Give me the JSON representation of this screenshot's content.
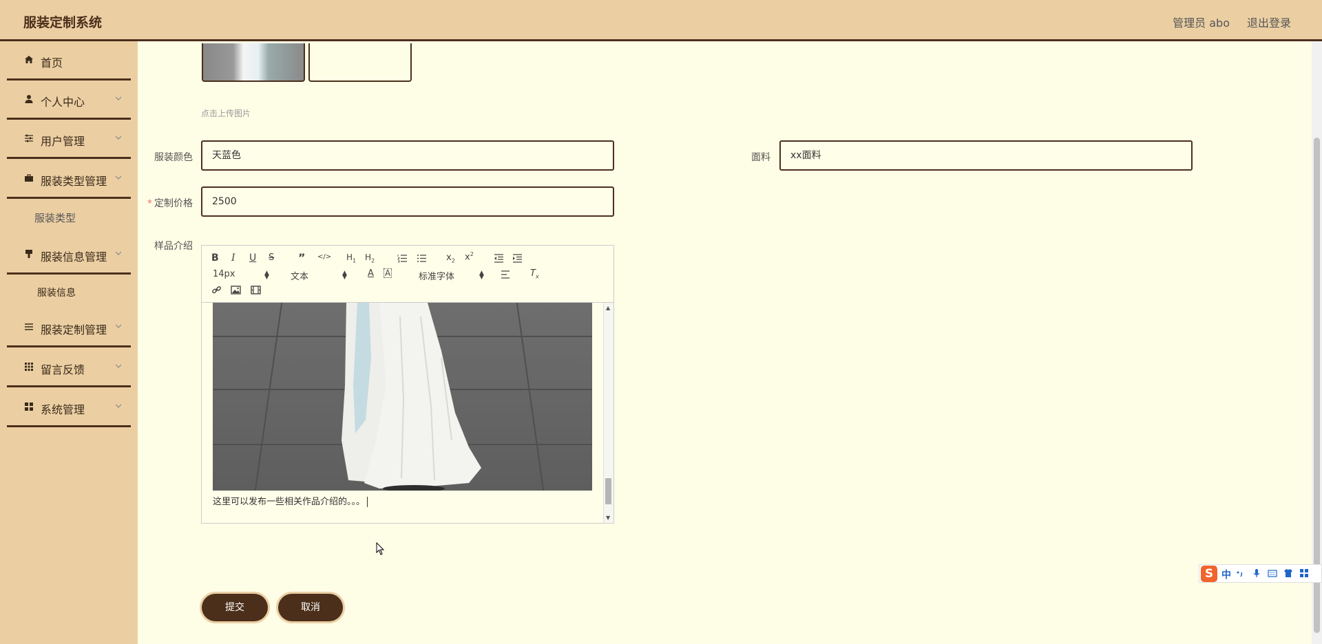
{
  "header": {
    "title": "服装定制系统",
    "user": "管理员 abo",
    "logout": "退出登录"
  },
  "sidebar": {
    "items": [
      {
        "label": "首页",
        "icon": "home-icon"
      },
      {
        "label": "个人中心",
        "icon": "user-icon"
      },
      {
        "label": "用户管理",
        "icon": "sliders-icon"
      },
      {
        "label": "服装类型管理",
        "icon": "briefcase-icon"
      },
      {
        "label": "服装信息管理",
        "icon": "brush-icon"
      },
      {
        "label": "服装定制管理",
        "icon": "list-icon"
      },
      {
        "label": "留言反馈",
        "icon": "grid-icon"
      },
      {
        "label": "系统管理",
        "icon": "apps-icon"
      }
    ],
    "subitems": {
      "type": "服装类型",
      "info": "服装信息"
    }
  },
  "form": {
    "upload_tip": "点击上传图片",
    "color_label": "服装颜色",
    "color_value": "天蓝色",
    "fabric_label": "面料",
    "fabric_value": "xx面料",
    "price_label": "定制价格",
    "price_value": "2500",
    "intro_label": "样品介绍",
    "required_mark": "*"
  },
  "editor": {
    "size": "14px",
    "header": "文本",
    "font": "标准字体",
    "content_text": "这里可以发布一些相关作品介绍的。。。"
  },
  "buttons": {
    "submit": "提交",
    "cancel": "取消"
  },
  "ime": {
    "logo": "S",
    "lang": "中"
  },
  "colors": {
    "accent": "#4b2f1b",
    "sidebar_bg": "#ebcfa3",
    "page_bg": "#fefde6"
  }
}
